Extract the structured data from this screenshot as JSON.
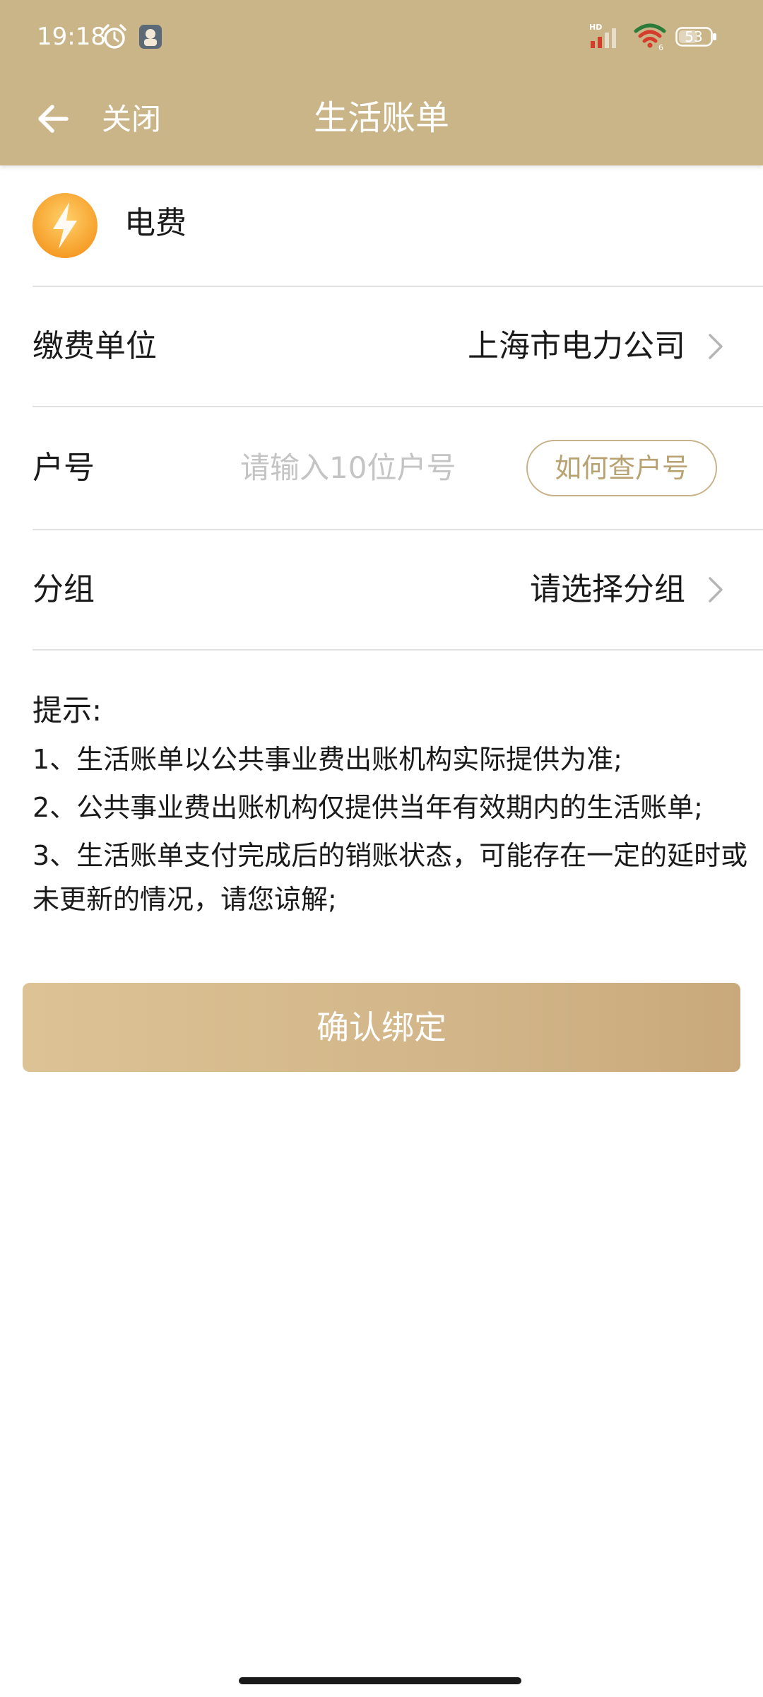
{
  "status_bar": {
    "time": "19:18",
    "battery": "53",
    "icons": [
      "alarm-icon",
      "app-notification-icon",
      "signal-icon",
      "wifi-icon",
      "battery-icon"
    ]
  },
  "nav": {
    "back_icon": "arrow-left-icon",
    "close_label": "关闭",
    "title": "生活账单"
  },
  "service": {
    "icon": "lightning-icon",
    "name": "电费"
  },
  "form": {
    "payee_label": "缴费单位",
    "payee_value": "上海市电力公司",
    "account_label": "户号",
    "account_placeholder": "请输入10位户号",
    "account_value": "",
    "help_label": "如何查户号",
    "group_label": "分组",
    "group_value": "请选择分组"
  },
  "tips": {
    "title": "提示:",
    "items": [
      "1、生活账单以公共事业费出账机构实际提供为准;",
      "2、公共事业费出账机构仅提供当年有效期内的生活账单;",
      "3、生活账单支付完成后的销账状态，可能存在一定的延时或未更新的情况，请您谅解;"
    ]
  },
  "confirm_label": "确认绑定",
  "colors": {
    "header": "#c9b587",
    "accent_text": "#b9a272",
    "button_gradient_start": "#dcc294",
    "button_gradient_end": "#c9a97b",
    "service_icon": "#f7a532"
  }
}
